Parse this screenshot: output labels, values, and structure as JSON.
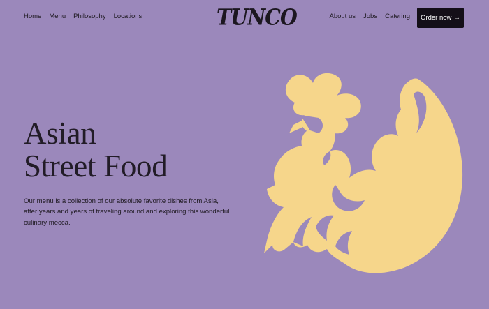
{
  "nav": {
    "left": [
      {
        "label": "Home"
      },
      {
        "label": "Menu"
      },
      {
        "label": "Philosophy"
      },
      {
        "label": "Locations"
      }
    ],
    "right": [
      {
        "label": "About us"
      },
      {
        "label": "Jobs"
      },
      {
        "label": "Catering"
      }
    ]
  },
  "logo": {
    "text": "TUNCO"
  },
  "order_button": {
    "label": "Order now",
    "arrow": "→"
  },
  "hero": {
    "title_line1": "Asian",
    "title_line2": "Street Food",
    "description": "Our menu is a collection of our absolute favorite dishes from Asia, after years and years of traveling around and exploring this wonderful culinary mecca."
  },
  "illustration": {
    "icon": "rooster-illustration",
    "color": "#f6d68b"
  },
  "colors": {
    "background": "#9b88bb",
    "text": "#1f1a22",
    "button_bg": "#140f18",
    "button_text": "#ffffff"
  }
}
